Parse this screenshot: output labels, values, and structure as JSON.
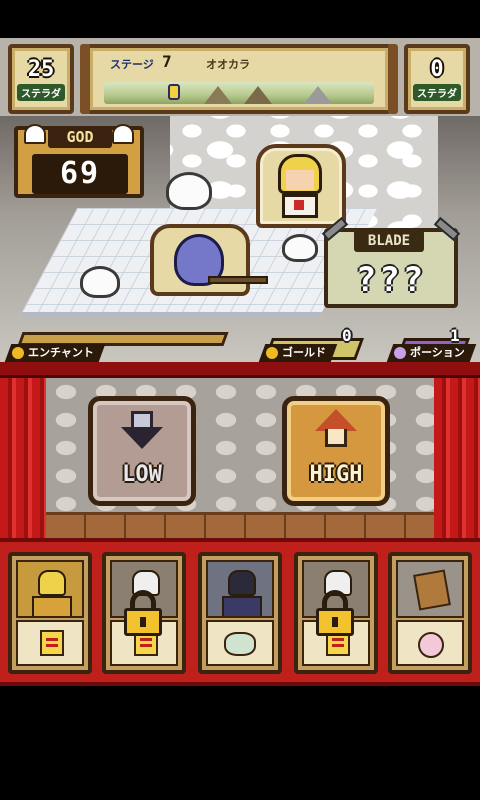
{
  "hud": {
    "left_counter": {
      "value": "25",
      "label": "ステラダ"
    },
    "right_counter": {
      "value": "0",
      "label": "ステラダ"
    },
    "stage": {
      "label": "ステージ",
      "number": "7",
      "name": "オオカラ"
    }
  },
  "god": {
    "label": "GOD",
    "value": "69"
  },
  "blade": {
    "label": "BLADE",
    "value": "???"
  },
  "resources": {
    "enchant": {
      "label": "エンチャント",
      "progress": 0
    },
    "gold": {
      "label": "ゴールド",
      "count": "0"
    },
    "potion": {
      "label": "ポーション",
      "count": "1"
    }
  },
  "buttons": {
    "low": "LOW",
    "high": "HIGH"
  },
  "item_slots": [
    {
      "name": "hero-slot",
      "locked": false
    },
    {
      "name": "locked-slot-1",
      "locked": true
    },
    {
      "name": "cat-slot",
      "locked": false
    },
    {
      "name": "locked-slot-2",
      "locked": true
    },
    {
      "name": "scroll-slot",
      "locked": false
    }
  ],
  "colors": {
    "curtain_red": "#c81a1a",
    "parchment": "#e6d9a5",
    "frame_brown": "#3a2410",
    "god_gold": "#d2a042",
    "high_orange": "#d6983f",
    "low_gray": "#b39c93"
  },
  "icons": [
    "gear-icon",
    "lock-icon",
    "arrow-down-icon",
    "arrow-up-icon",
    "scroll-icon",
    "coin-icon",
    "sword-icon"
  ]
}
